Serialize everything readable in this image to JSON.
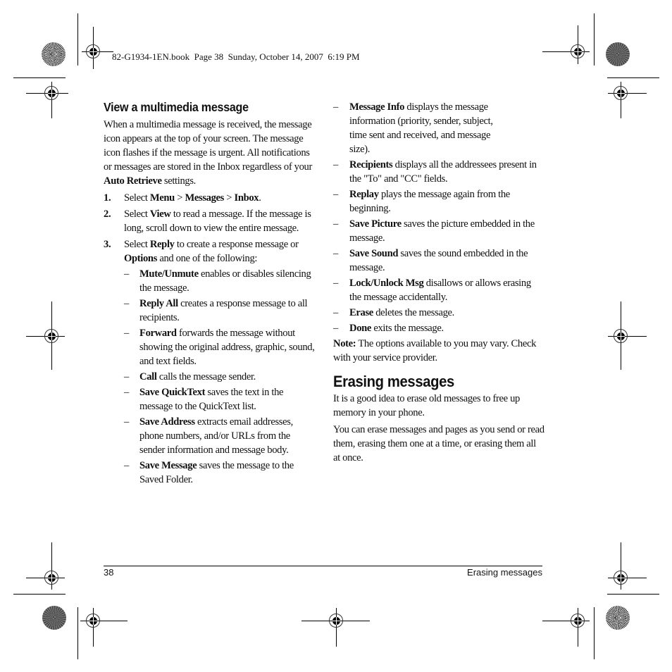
{
  "slug": "82-G1934-1EN.book  Page 38  Sunday, October 14, 2007  6:19 PM",
  "left": {
    "heading": "View a multimedia message",
    "intro": {
      "text": "When a multimedia message is received, the message icon appears at the top of your screen. The message icon flashes if the message is urgent. All notifications or messages are stored in the Inbox regardless of your ",
      "bold": "Auto Retrieve",
      "after": " settings."
    },
    "steps": [
      {
        "num": "1.",
        "parts": [
          {
            "t": "Select "
          },
          {
            "b": "Menu"
          },
          {
            "t": " > "
          },
          {
            "b": "Messages"
          },
          {
            "t": " > "
          },
          {
            "b": "Inbox"
          },
          {
            "t": "."
          }
        ]
      },
      {
        "num": "2.",
        "parts": [
          {
            "t": "Select "
          },
          {
            "b": "View"
          },
          {
            "t": " to read a message. If the message is long, scroll down to view the entire message."
          }
        ]
      },
      {
        "num": "3.",
        "parts": [
          {
            "t": "Select "
          },
          {
            "b": "Reply"
          },
          {
            "t": " to create a response message or "
          },
          {
            "b": "Options"
          },
          {
            "t": " and one of the following:"
          }
        ]
      }
    ],
    "options": [
      {
        "name": "Mute/Unmute",
        "desc": " enables or disables silencing the message."
      },
      {
        "name": "Reply All",
        "desc": " creates a response message to all recipients."
      },
      {
        "name": "Forward",
        "desc": " forwards the message without showing the original address, graphic, sound, and text fields."
      },
      {
        "name": "Call",
        "desc": " calls the message sender."
      },
      {
        "name": "Save QuickText",
        "desc": " saves the text in the message to the QuickText list."
      },
      {
        "name": "Save Address",
        "desc": " extracts email addresses, phone numbers, and/or URLs from the sender information and message body."
      },
      {
        "name": "Save Message",
        "desc": " saves the message to the Saved Folder."
      }
    ]
  },
  "right": {
    "options": [
      {
        "name": "Message Info",
        "desc": " displays the message information (priority, sender, subject, time sent and received, and message size)."
      },
      {
        "name": "Recipients",
        "desc": " displays all the addressees present in the \"To\" and \"CC\" fields."
      },
      {
        "name": "Replay",
        "desc": " plays the message again from the beginning."
      },
      {
        "name": "Save Picture",
        "desc": " saves the picture embedded in the message."
      },
      {
        "name": "Save Sound",
        "desc": " saves the sound embedded in the message."
      },
      {
        "name": "Lock/Unlock Msg",
        "desc": " disallows or allows erasing the message accidentally."
      },
      {
        "name": "Erase",
        "desc": " deletes the message."
      },
      {
        "name": "Done",
        "desc": " exits the message."
      }
    ],
    "note_label": "Note:",
    "note_text": " The options available to you may vary. Check with your service provider.",
    "heading": "Erasing messages",
    "para1": "It is a good idea to erase old messages to free up memory in your phone.",
    "para2": "You can erase messages and pages as you send or read them, erasing them one at a time, or erasing them all at once."
  },
  "footer": {
    "page_number": "38",
    "section": "Erasing messages"
  },
  "dash": "–"
}
